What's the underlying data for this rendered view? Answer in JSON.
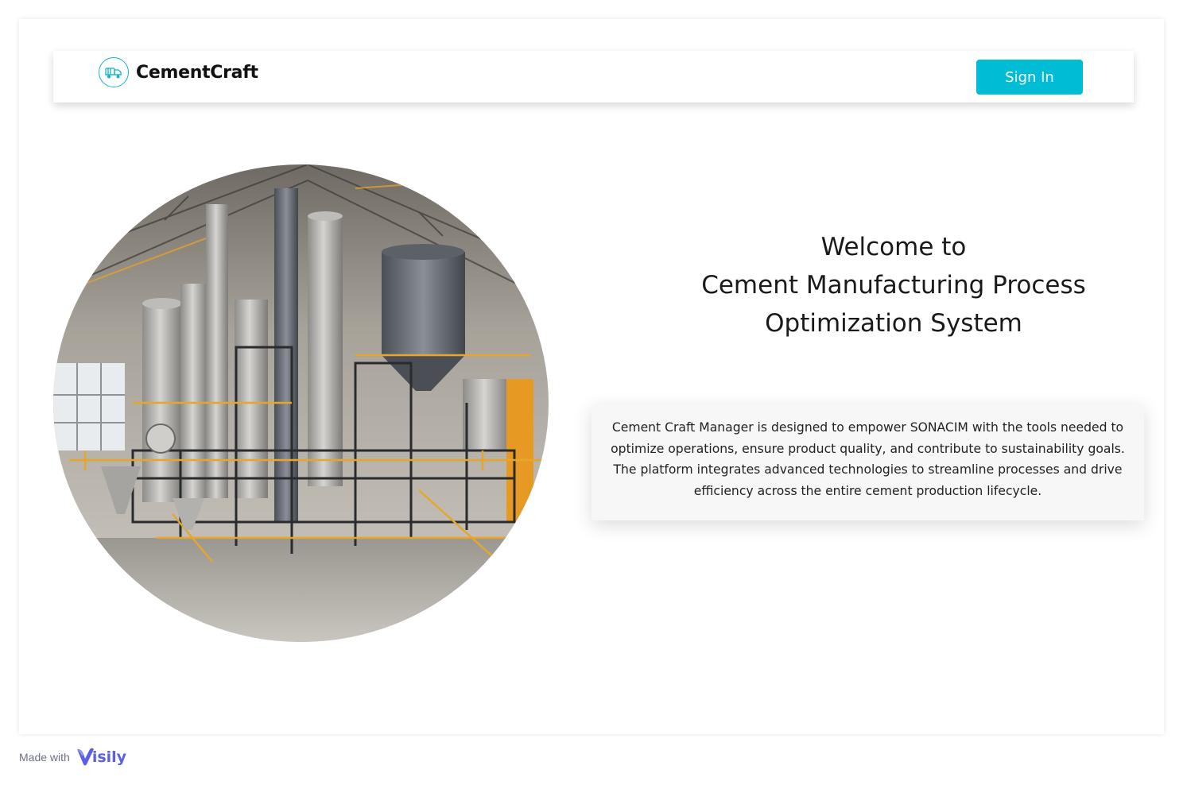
{
  "brand": {
    "name": "CementCraft",
    "icon": "cement-truck-icon",
    "accent": "#12b5c9"
  },
  "nav": {
    "signin_label": "Sign In",
    "button_color": "#00bcd4"
  },
  "hero": {
    "image": "cement-factory-photo",
    "title_lines": [
      "Welcome to",
      "Cement Manufacturing Process",
      "Optimization System"
    ]
  },
  "description": {
    "lines": [
      "Cement Craft Manager is designed to empower SONACIM with the tools needed to",
      "optimize operations, ensure product quality, and contribute to sustainability goals.",
      "The platform integrates advanced technologies to streamline processes and drive",
      "efficiency across the entire cement production lifecycle."
    ]
  },
  "footer": {
    "made_with": "Made with",
    "tool_name": "isily",
    "tool_icon": "visily-v-icon",
    "tool_color": "#5b5ee6"
  }
}
